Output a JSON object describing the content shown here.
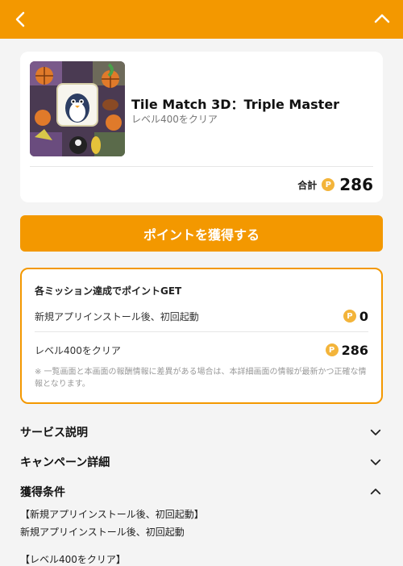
{
  "header": {
    "back_icon": "chevron-left-icon",
    "collapse_icon": "chevron-up-icon",
    "bg_color": "#f39800"
  },
  "app": {
    "name": "Tile Match 3D：Triple Master",
    "subtitle": "レベル400をクリア",
    "total_label": "合計",
    "coin_symbol": "P",
    "total_points": "286"
  },
  "cta": {
    "label": "ポイントを獲得する"
  },
  "missions": {
    "title": "各ミッション達成でポイントGET",
    "items": [
      {
        "label": "新規アプリインストール後、初回起動",
        "points": "0"
      },
      {
        "label": "レベル400をクリア",
        "points": "286"
      }
    ],
    "note": "※ 一覧画面と本画面の報酬情報に差異がある場合は、本詳細画面の情報が最新かつ正確な情報となります。"
  },
  "sections": [
    {
      "title": "サービス説明",
      "state": "collapsed"
    },
    {
      "title": "キャンペーン詳細",
      "state": "collapsed"
    },
    {
      "title": "獲得条件",
      "state": "expanded"
    }
  ],
  "conditions": {
    "line1": "【新規アプリインストール後、初回起動】",
    "line2": "新規アプリインストール後、初回起動",
    "line3": "【レベル400をクリア】"
  },
  "colors": {
    "accent": "#f39800",
    "coin": "#f3b43a"
  }
}
